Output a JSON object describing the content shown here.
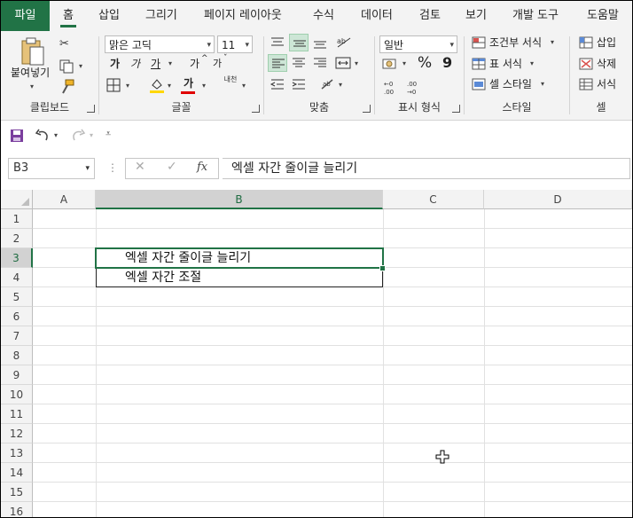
{
  "ribbon_tabs": [
    "파일",
    "홈",
    "삽입",
    "그리기",
    "페이지 레이아웃",
    "수식",
    "데이터",
    "검토",
    "보기",
    "개발 도구",
    "도움말"
  ],
  "clipboard": {
    "paste_label": "붙여넣기",
    "group_label": "클립보드"
  },
  "font": {
    "name": "맑은 고딕",
    "size": "11",
    "bold": "가",
    "italic": "가",
    "underline": "가",
    "grow": "가",
    "shrink": "가",
    "color_glyph": "가",
    "phonetic": "내천",
    "group_label": "글꼴"
  },
  "alignment": {
    "group_label": "맞춤"
  },
  "number": {
    "format": "일반",
    "percent": "%",
    "comma": "9",
    "group_label": "표시 형식"
  },
  "styles": {
    "conditional": "조건부 서식",
    "table": "표 서식",
    "cell_styles": "셀 스타일",
    "group_label": "스타일"
  },
  "cells": {
    "insert": "삽입",
    "delete": "삭제",
    "format": "서식",
    "group_label": "셀"
  },
  "formula_bar": {
    "name_box": "B3",
    "fx": "fx",
    "content": "엑셀 자간 줄이글 늘리기"
  },
  "columns": [
    "A",
    "B",
    "C",
    "D"
  ],
  "rows": [
    "1",
    "2",
    "3",
    "4",
    "5",
    "6",
    "7",
    "8",
    "9",
    "10",
    "11",
    "12",
    "13",
    "14",
    "15",
    "16"
  ],
  "cells_content": {
    "B3": "엑셀 자간 줄이글 늘리기",
    "B4": "엑셀 자간 조절"
  },
  "colors": {
    "accent": "#217346",
    "font_color_bar": "#e00000",
    "fill_color_bar": "#ffd700"
  }
}
